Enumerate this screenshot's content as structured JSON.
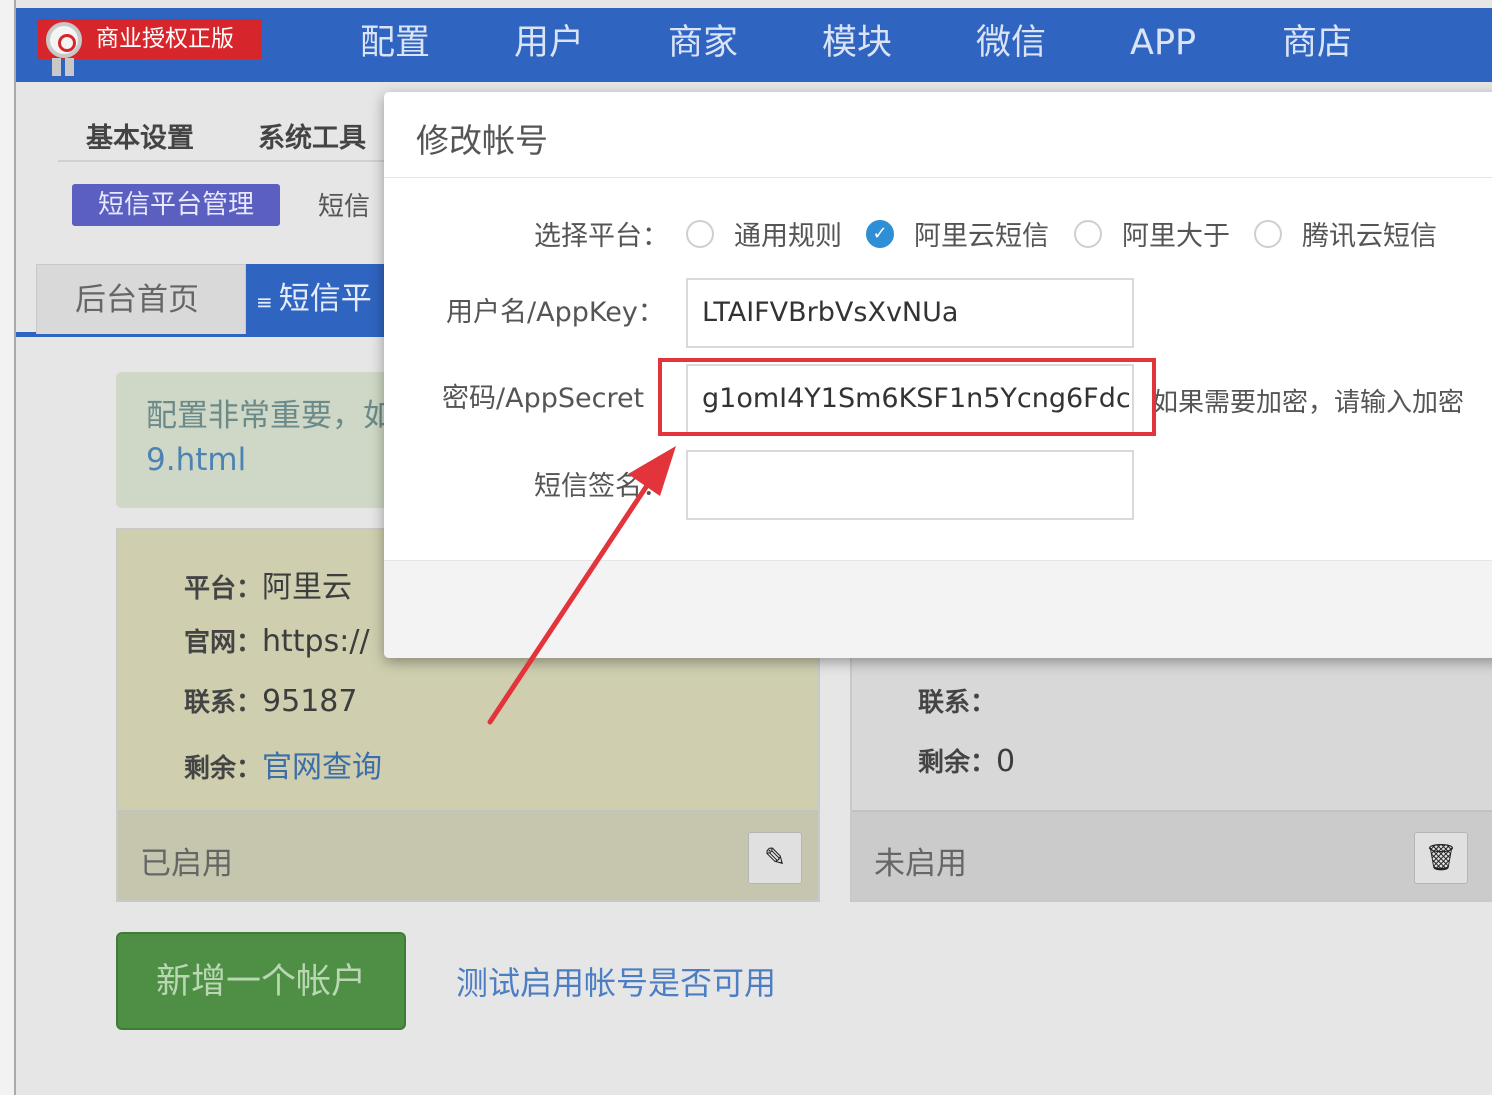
{
  "topbar": {
    "badge": "商业授权正版",
    "nav": [
      "配置",
      "用户",
      "商家",
      "模块",
      "微信",
      "APP",
      "商店"
    ]
  },
  "subnav": {
    "items": [
      "基本设置",
      "系统工具"
    ],
    "active_pill": "短信平台管理",
    "second_tab": "短信"
  },
  "tabs": {
    "home": "后台首页",
    "sms": "短信平"
  },
  "notice": {
    "line1": "配置非常重要，如",
    "line2": "9.html"
  },
  "card1": {
    "platform_key": "平台：",
    "platform_val": "阿里云",
    "site_key": "官网：",
    "site_val": "https://",
    "contact_key": "联系：",
    "contact_val": "95187",
    "remain_key": "剩余：",
    "remain_val": "官网查询",
    "status": "已启用"
  },
  "card2": {
    "contact_key": "联系：",
    "contact_val": "",
    "remain_key": "剩余：",
    "remain_val": "0",
    "status": "未启用"
  },
  "add_button": "新增一个帐户",
  "test_link": "测试启用帐号是否可用",
  "modal": {
    "title": "修改帐号",
    "platform_label": "选择平台：",
    "platforms": [
      "通用规则",
      "阿里云短信",
      "阿里大于",
      "腾讯云短信"
    ],
    "selected_platform": "阿里云短信",
    "username_label": "用户名/AppKey：",
    "username_value": "LTAIFVBrbVsXvNUa",
    "secret_label": "密码/AppSecret",
    "secret_value": "g1omI4Y1Sm6KSF1n5Ycng6Fdc",
    "secret_hint": "如果需要加密，请输入加密",
    "sign_label": "短信签名：",
    "sign_value": ""
  },
  "colors": {
    "topbar": "#2f64c0",
    "badge": "#d7262b",
    "highlight": "#e3333b",
    "radio_on": "#2e8fd6"
  }
}
